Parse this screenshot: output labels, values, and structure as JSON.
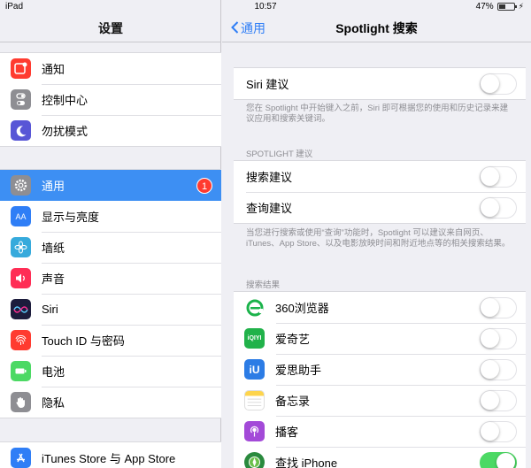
{
  "status_bar": {
    "device": "iPad",
    "time": "10:57",
    "battery": "47%",
    "battery_level": 0.47
  },
  "left": {
    "title": "设置",
    "group1": [
      {
        "label": "通知",
        "icon": "notifications-icon",
        "color": "#ff3b30"
      },
      {
        "label": "控制中心",
        "icon": "control-center-icon",
        "color": "#8e8e93"
      },
      {
        "label": "勿扰模式",
        "icon": "moon-icon",
        "color": "#5856d6"
      }
    ],
    "group2": [
      {
        "label": "通用",
        "icon": "gear-icon",
        "color": "#8e8e93",
        "badge": "1"
      },
      {
        "label": "显示与亮度",
        "icon": "display-brightness-icon",
        "color": "#2f7ef6"
      },
      {
        "label": "墙纸",
        "icon": "wallpaper-icon",
        "color": "#36aadc"
      },
      {
        "label": "声音",
        "icon": "sound-icon",
        "color": "#ff2d55"
      },
      {
        "label": "Siri",
        "icon": "siri-icon",
        "color": "#1c1c3c"
      },
      {
        "label": "Touch ID 与密码",
        "icon": "fingerprint-icon",
        "color": "#ff3b30"
      },
      {
        "label": "电池",
        "icon": "battery-icon",
        "color": "#4cd964"
      },
      {
        "label": "隐私",
        "icon": "hand-icon",
        "color": "#8e8e93"
      }
    ],
    "group3": [
      {
        "label": "iTunes Store 与 App Store",
        "icon": "app-store-icon",
        "color": "#2f7ef6"
      }
    ]
  },
  "right": {
    "back": "通用",
    "title": "Spotlight 搜索",
    "siri_label": "Siri 建议",
    "siri_note": "您在 Spotlight 中开始键入之前，Siri 即可根据您的使用和历史记录来建议应用和搜索关键词。",
    "section_spotlight": "SPOTLIGHT 建议",
    "search_suggest": "搜索建议",
    "lookup_suggest": "查询建议",
    "spotlight_note": "当您进行搜索或使用“查询”功能时，Spotlight 可以建议来自网页、iTunes、App Store、以及电影放映时间和附近地点等的相关搜索结果。",
    "section_results": "搜索结果",
    "apps": [
      {
        "label": "360浏览器",
        "icon": "360-browser-icon",
        "color": "#ffffff",
        "on": false
      },
      {
        "label": "爱奇艺",
        "icon": "iqiyi-icon",
        "color": "#21b24a",
        "on": false
      },
      {
        "label": "爱思助手",
        "icon": "i4-assistant-icon",
        "color": "#2c7ce5",
        "on": false
      },
      {
        "label": "备忘录",
        "icon": "notes-icon",
        "color": "#ffffff",
        "on": false
      },
      {
        "label": "播客",
        "icon": "podcast-icon",
        "color": "#a34ad8",
        "on": false
      },
      {
        "label": "查找 iPhone",
        "icon": "find-iphone-icon",
        "color": "#2a8a3e",
        "on": true
      }
    ]
  }
}
